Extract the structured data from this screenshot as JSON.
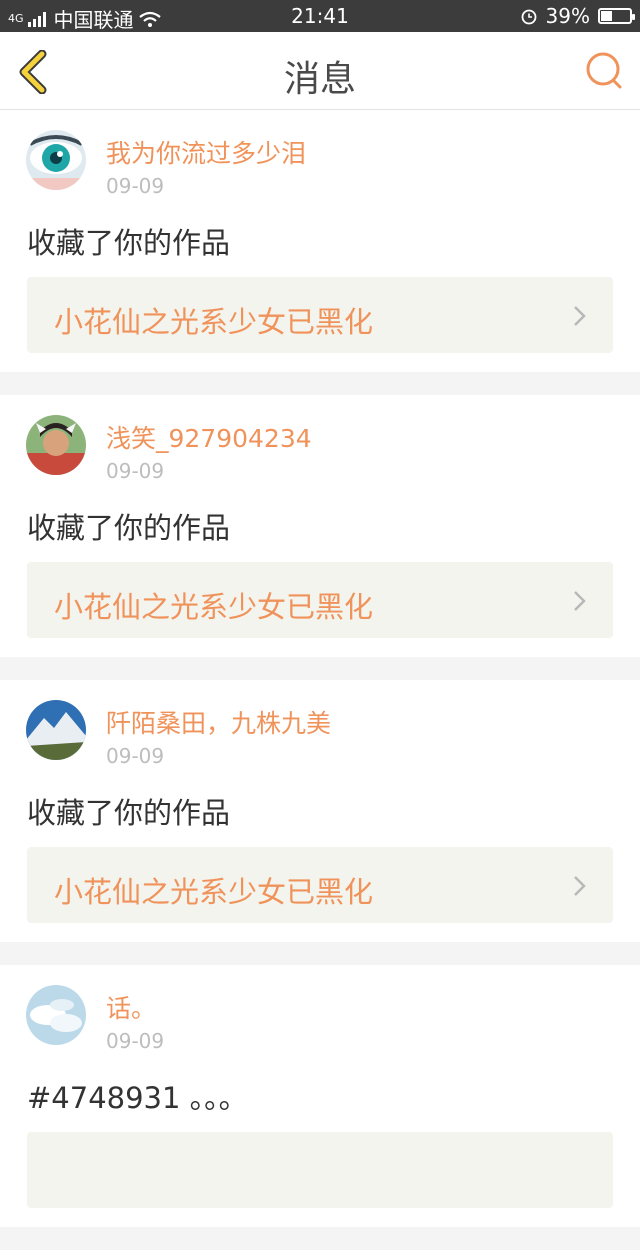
{
  "status_bar": {
    "network": "4G",
    "carrier": "中国联通",
    "time": "21:41",
    "battery_percent": "39%",
    "battery_level": 0.39
  },
  "navbar": {
    "title": "消息",
    "back_icon": "chevron-left-icon",
    "search_icon": "search-icon",
    "accent_color": "#f0935b"
  },
  "messages": [
    {
      "username": "我为你流过多少泪",
      "date": "09-09",
      "action": "收藏了你的作品",
      "work_title": "小花仙之光系少女已黑化"
    },
    {
      "username": "浅笑_927904234",
      "date": "09-09",
      "action": "收藏了你的作品",
      "work_title": "小花仙之光系少女已黑化"
    },
    {
      "username": "阡陌桑田，九株九美",
      "date": "09-09",
      "action": "收藏了你的作品",
      "work_title": "小花仙之光系少女已黑化"
    },
    {
      "username": "话。",
      "date": "09-09",
      "action": "#4748931 。。。",
      "work_title": ""
    }
  ]
}
